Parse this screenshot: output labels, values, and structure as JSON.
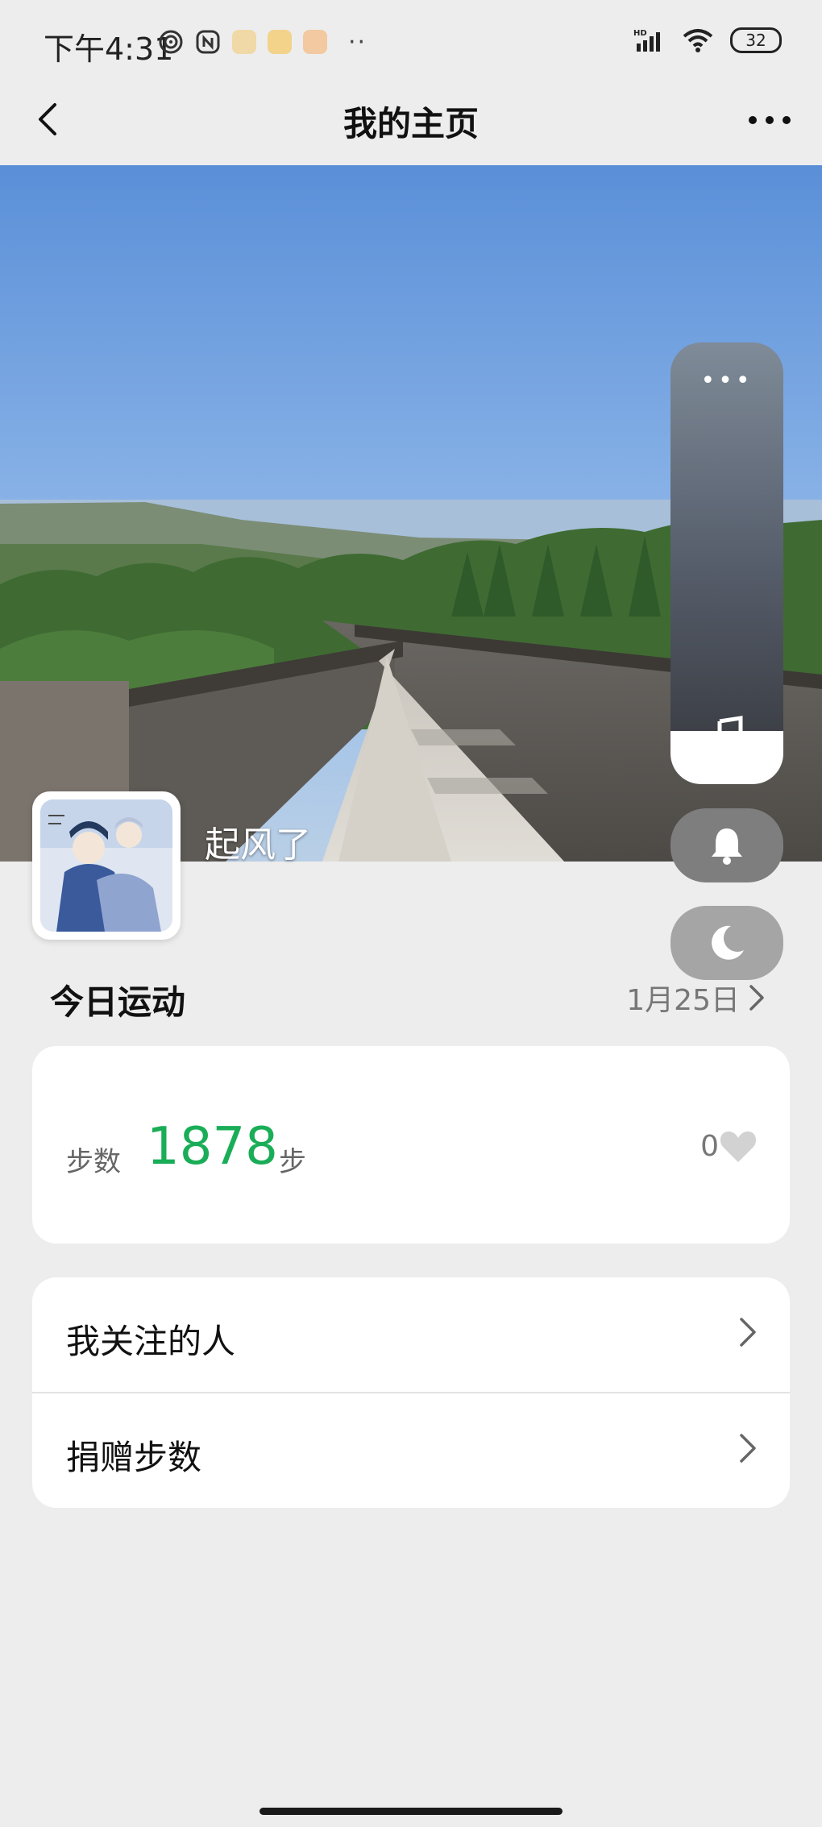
{
  "status_bar": {
    "time": "下午4:31",
    "battery": "32",
    "more": "··"
  },
  "nav": {
    "title": "我的主页"
  },
  "profile": {
    "name": "起风了"
  },
  "today": {
    "title": "今日运动",
    "date": "1月25日"
  },
  "steps": {
    "label": "步数",
    "value": "1878",
    "unit": "步",
    "likes": "0"
  },
  "list": [
    {
      "label": "我关注的人"
    },
    {
      "label": "捐赠步数"
    }
  ],
  "side_controls": {
    "dots": "•••"
  },
  "colors": {
    "accent_green": "#1aad58",
    "background": "#ededed"
  },
  "icons": [
    "back-arrow-icon",
    "more-icon",
    "music-note-icon",
    "bell-icon",
    "moon-icon",
    "heart-icon",
    "chevron-right-icon"
  ]
}
